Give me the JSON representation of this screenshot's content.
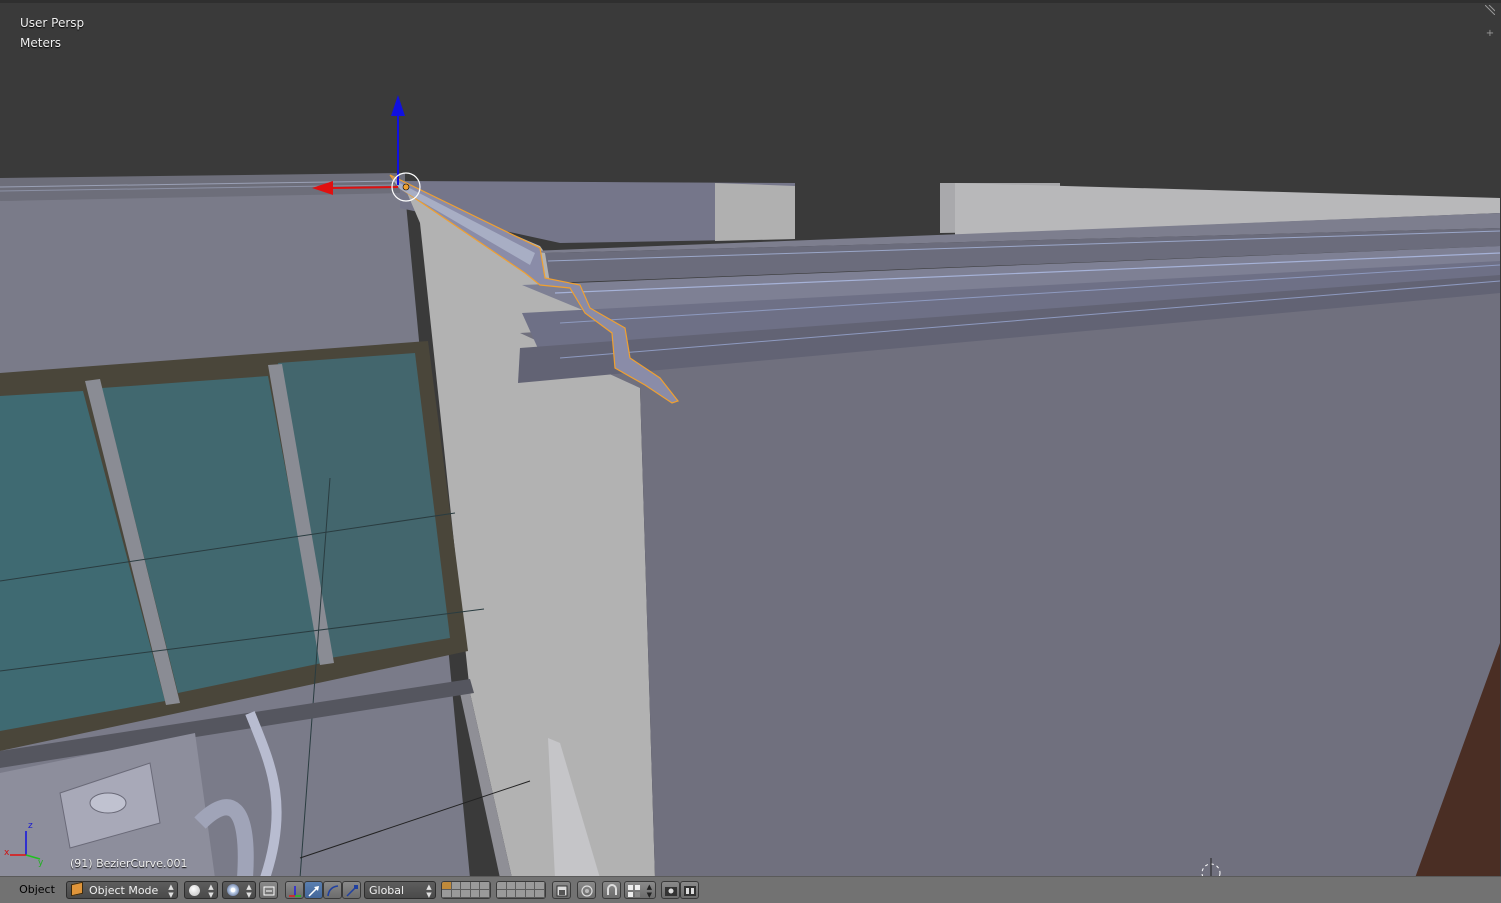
{
  "viewport": {
    "view_name": "User Persp",
    "units": "Meters",
    "object_info": "(91) BezierCurve.001",
    "plus_widget": "+"
  },
  "header": {
    "menu_object": "Object",
    "mode": "Object Mode",
    "orientation": "Global"
  },
  "icons": {
    "mode": "object-cube-icon",
    "shading": "solid-sphere-icon",
    "pivot": "pivot-point-icon",
    "manipulator": "manipulator-axes-icon",
    "translate": "translate-arrow-icon",
    "rotate": "rotate-arc-icon",
    "scale": "scale-arrow-icon",
    "layers": "layers-grid-icon",
    "lock_camera": "lock-layer-icon",
    "proportional": "proportional-edit-icon",
    "snap": "snap-magnet-icon",
    "snap_target": "snap-target-icon",
    "opengl_render": "render-still-icon",
    "opengl_anim": "render-anim-icon"
  },
  "colors": {
    "selection_outline": "#f0a030",
    "axis_x": "#e01010",
    "axis_y": "#20c020",
    "axis_z": "#1010e0",
    "active_button": "#5a7fb0",
    "header_bg": "#727272",
    "viewport_bg": "#3a3a3a"
  }
}
